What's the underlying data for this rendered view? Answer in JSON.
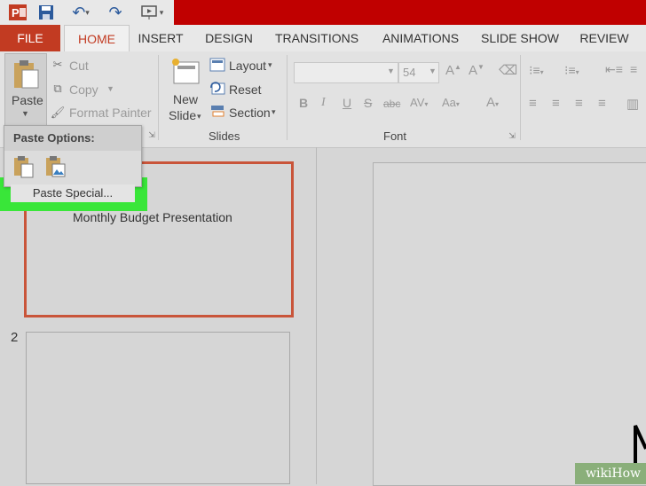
{
  "tabs": [
    "FILE",
    "HOME",
    "INSERT",
    "DESIGN",
    "TRANSITIONS",
    "ANIMATIONS",
    "SLIDE SHOW",
    "REVIEW"
  ],
  "clipboard": {
    "paste": "Paste",
    "cut": "Cut",
    "copy": "Copy",
    "format_painter": "Format Painter"
  },
  "slides": {
    "new_slide_1": "New",
    "new_slide_2": "Slide",
    "layout": "Layout",
    "reset": "Reset",
    "section": "Section",
    "group_label": "Slides"
  },
  "font": {
    "size": "54",
    "group_label": "Font"
  },
  "paste_menu": {
    "header": "Paste Options:",
    "paste_special": "Paste Special..."
  },
  "slide_panel": {
    "slide1_title": "Monthly Budget Presentation",
    "slide2_number": "2"
  },
  "watermark": {
    "text": "wikiHow"
  },
  "colors": {
    "accent": "#c23b22",
    "highlight": "#39e639",
    "title_bar": "#c00000"
  }
}
